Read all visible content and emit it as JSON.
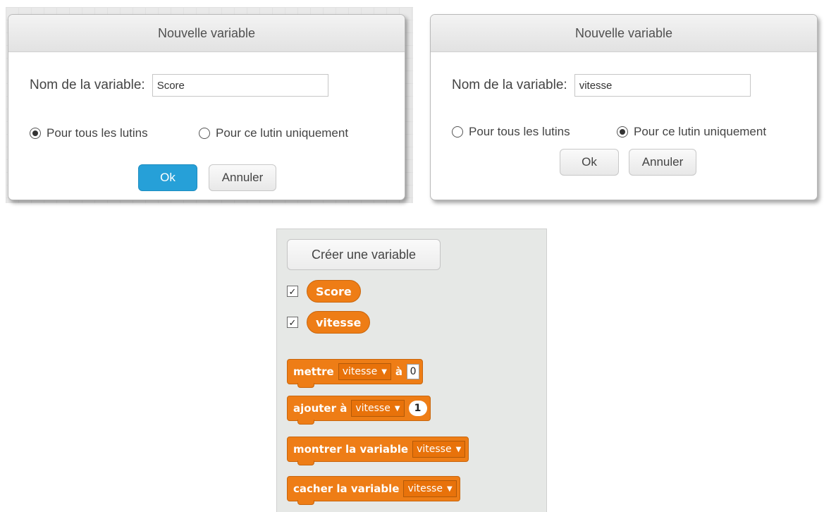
{
  "dialogs": [
    {
      "title": "Nouvelle variable",
      "name_label": "Nom de la variable:",
      "name_value": "Score",
      "radio_all": "Pour tous les lutins",
      "radio_this": "Pour ce lutin uniquement",
      "selected": "all",
      "ok_label": "Ok",
      "cancel_label": "Annuler"
    },
    {
      "title": "Nouvelle variable",
      "name_label": "Nom de la variable:",
      "name_value": "vitesse",
      "radio_all": "Pour tous les lutins",
      "radio_this": "Pour ce lutin uniquement",
      "selected": "this",
      "ok_label": "Ok",
      "cancel_label": "Annuler"
    }
  ],
  "palette": {
    "create_button": "Créer une variable",
    "variables": [
      {
        "name": "Score",
        "checked": true
      },
      {
        "name": "vitesse",
        "checked": true
      }
    ],
    "blocks": {
      "set": {
        "word1": "mettre",
        "var": "vitesse",
        "word2": "à",
        "value": "0"
      },
      "change": {
        "word1": "ajouter à",
        "var": "vitesse",
        "value": "1"
      },
      "show": {
        "word1": "montrer la variable",
        "var": "vitesse"
      },
      "hide": {
        "word1": "cacher la variable",
        "var": "vitesse"
      }
    }
  },
  "colors": {
    "block_orange": "#ee7d16",
    "ok_blue": "#26a0d8"
  }
}
